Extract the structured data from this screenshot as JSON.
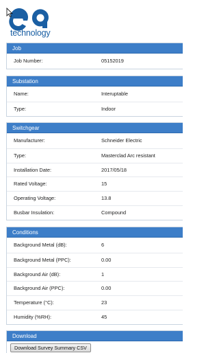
{
  "brand": {
    "logo_text": "technology",
    "color": "#1a5fa3"
  },
  "job": {
    "title": "Job",
    "rows": [
      {
        "label": "Job Number:",
        "value": "05152019"
      }
    ]
  },
  "substation": {
    "title": "Substation",
    "rows": [
      {
        "label": "Name:",
        "value": "Interuptable"
      },
      {
        "label": "Type:",
        "value": "Indoor"
      }
    ]
  },
  "switchgear": {
    "title": "Switchgear",
    "rows": [
      {
        "label": "Manufacturer:",
        "value": "Schneider Electric"
      },
      {
        "label": "Type:",
        "value": "Masterclad Arc resistant"
      },
      {
        "label": "Installation Date:",
        "value": "2017/05/18"
      },
      {
        "label": "Rated Voltage:",
        "value": "15"
      },
      {
        "label": "Operating Voltage:",
        "value": "13.8"
      },
      {
        "label": "Busbar Insulation:",
        "value": "Compound"
      }
    ]
  },
  "conditions": {
    "title": "Conditions",
    "rows": [
      {
        "label": "Background Metal (dB):",
        "value": "6"
      },
      {
        "label": "Background Metal (PPC):",
        "value": "0.00"
      },
      {
        "label": "Background Air (dB):",
        "value": "1"
      },
      {
        "label": "Background Air (PPC):",
        "value": "0.00"
      },
      {
        "label": "Temperature (°C):",
        "value": "23"
      },
      {
        "label": "Humidity (%RH):",
        "value": "45"
      }
    ]
  },
  "download": {
    "title": "Download",
    "button_label": "Download Survey Summary CSV"
  },
  "colors": {
    "header": "#3d7ec8",
    "border": "#c9d4e0"
  }
}
